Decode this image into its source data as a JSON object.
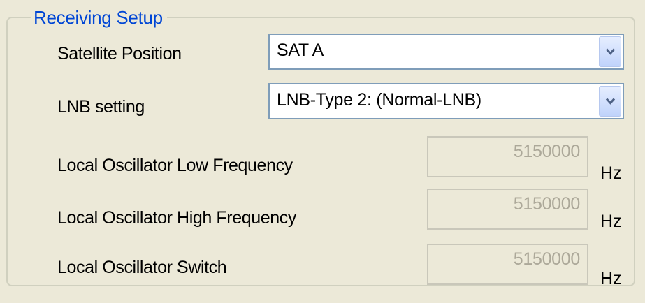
{
  "group": {
    "title": "Receiving Setup"
  },
  "satellite": {
    "label": "Satellite Position",
    "value": "SAT A",
    "dropdown_icon": "chevron-down-icon"
  },
  "lnb": {
    "label": "LNB setting",
    "value": "LNB-Type 2: (Normal-LNB)",
    "dropdown_icon": "chevron-down-icon"
  },
  "lo_low": {
    "label": "Local Oscillator Low Frequency",
    "value": "5150000",
    "unit": "Hz"
  },
  "lo_high": {
    "label": "Local Oscillator High Frequency",
    "value": "5150000",
    "unit": "Hz"
  },
  "lo_switch": {
    "label": "Local Oscillator Switch",
    "value": "5150000",
    "unit": "Hz"
  },
  "colors": {
    "background": "#ece9d8",
    "group_title": "#0046d5",
    "disabled_text": "#aca899",
    "combo_border": "#7f9db9"
  }
}
